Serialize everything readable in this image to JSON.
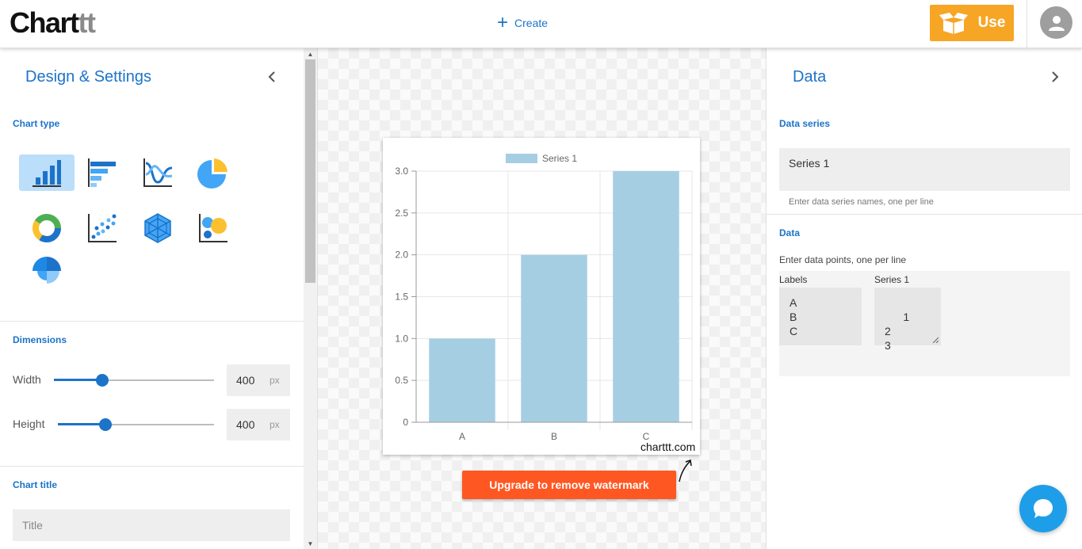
{
  "app": {
    "logo_main": "Chart",
    "logo_dim": "tt"
  },
  "topbar": {
    "create_label": "Create",
    "use_label": "Use"
  },
  "left_panel": {
    "title": "Design & Settings",
    "chart_type_label": "Chart type",
    "chart_types": [
      "vertical-bar",
      "horizontal-bar",
      "line",
      "pie",
      "doughnut",
      "scatter",
      "radar",
      "bubble",
      "polar-area"
    ],
    "selected_chart_type": "vertical-bar",
    "dimensions_label": "Dimensions",
    "width_label": "Width",
    "width_value": "400",
    "height_label": "Height",
    "height_value": "400",
    "unit": "px",
    "chart_title_label": "Chart title",
    "title_placeholder": "Title"
  },
  "canvas": {
    "watermark": "charttt.com",
    "upgrade_label": "Upgrade to remove watermark"
  },
  "right_panel": {
    "title": "Data",
    "data_series_label": "Data series",
    "series_value": "Series 1",
    "series_hint": "Enter data series names, one per line",
    "data_label": "Data",
    "data_hint": "Enter data points, one per line",
    "labels_col": "Labels",
    "series_col": "Series 1",
    "labels_values": "A\nB\nC",
    "series_values": "1\n2\n3"
  },
  "colors": {
    "accent": "#1c73c9",
    "use_button": "#f7a525",
    "upgrade_button": "#ff5722",
    "bar_fill": "#a6cee3",
    "chat_bubble": "#1e9ee8"
  },
  "chart_data": {
    "type": "bar",
    "categories": [
      "A",
      "B",
      "C"
    ],
    "series": [
      {
        "name": "Series 1",
        "values": [
          1,
          2,
          3
        ]
      }
    ],
    "ylim": [
      0,
      3
    ],
    "yticks": [
      "0",
      "0.5",
      "1.0",
      "1.5",
      "2.0",
      "2.5",
      "3.0"
    ],
    "legend": "top",
    "grid": true
  }
}
